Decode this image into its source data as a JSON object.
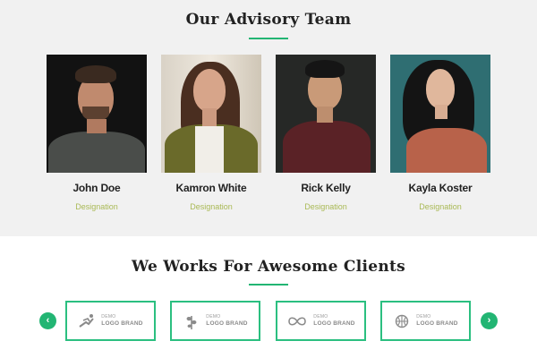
{
  "team": {
    "title": "Our Advisory Team",
    "members": [
      {
        "name": "John Doe",
        "role": "Designation"
      },
      {
        "name": "Kamron White",
        "role": "Designation"
      },
      {
        "name": "Rick Kelly",
        "role": "Designation"
      },
      {
        "name": "Kayla Koster",
        "role": "Designation"
      }
    ]
  },
  "clients": {
    "title": "We Works For Awesome Clients",
    "prev_icon": "chevron-left-icon",
    "next_icon": "chevron-right-icon",
    "logos": [
      {
        "demo": "DEMO",
        "brand": "LOGO BRAND",
        "icon": "runner-icon"
      },
      {
        "demo": "DEMO",
        "brand": "LOGO BRAND",
        "icon": "leaf-icon"
      },
      {
        "demo": "DEMO",
        "brand": "LOGO BRAND",
        "icon": "infinity-icon"
      },
      {
        "demo": "DEMO",
        "brand": "LOGO BRAND",
        "icon": "basketball-icon"
      }
    ]
  },
  "colors": {
    "accent": "#22b573",
    "section_bg": "#f1f1f1",
    "designation": "#a9b955"
  }
}
